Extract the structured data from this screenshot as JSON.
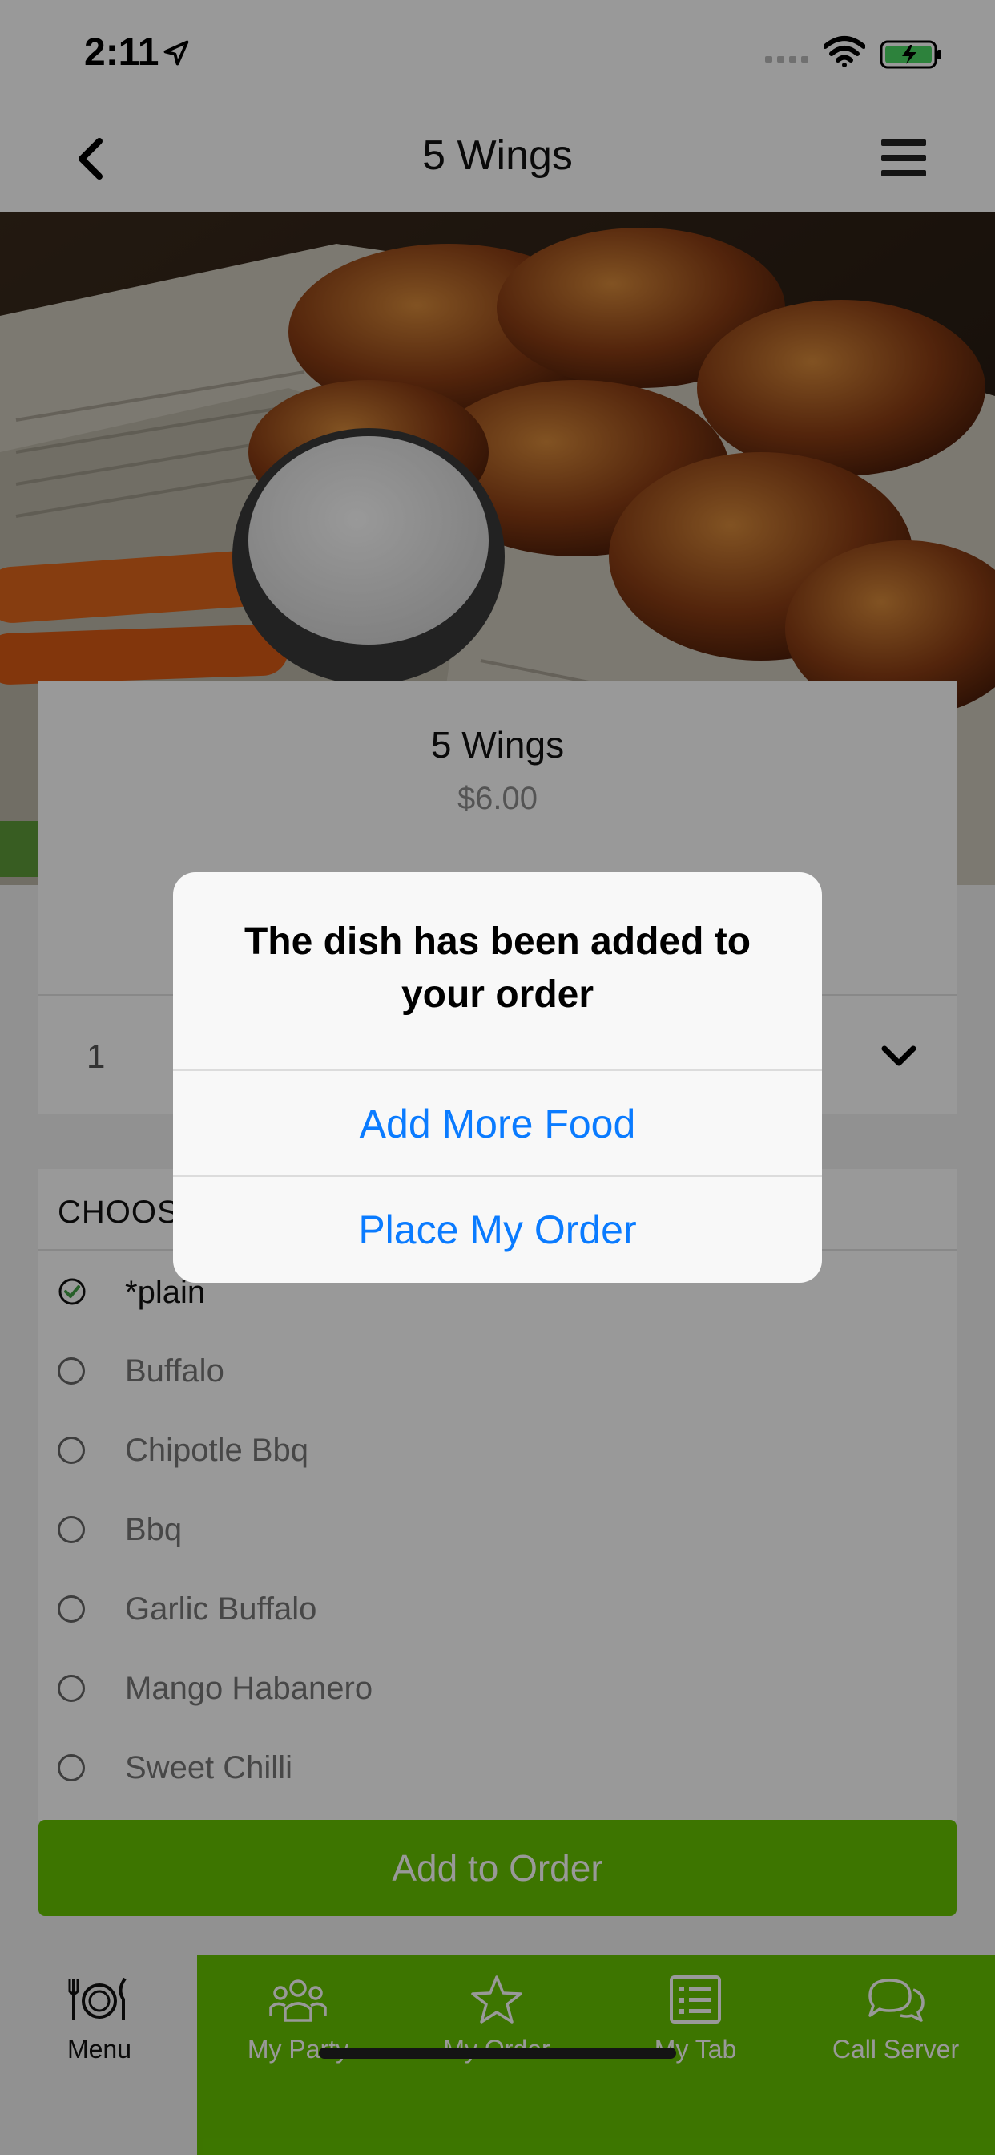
{
  "status_bar": {
    "time": "2:11",
    "icons": [
      "location-arrow-icon",
      "signal-icon",
      "wifi-icon",
      "battery-icon"
    ]
  },
  "nav": {
    "title": "5 Wings",
    "back_icon": "chevron-left-icon",
    "menu_icon": "hamburger-menu-icon"
  },
  "item": {
    "name": "5 Wings",
    "price": "$6.00",
    "quantity": "1"
  },
  "options": {
    "header": "CHOOS",
    "items": [
      {
        "label": "*plain",
        "selected": true
      },
      {
        "label": "Buffalo",
        "selected": false
      },
      {
        "label": "Chipotle Bbq",
        "selected": false
      },
      {
        "label": "Bbq",
        "selected": false
      },
      {
        "label": "Garlic Buffalo",
        "selected": false
      },
      {
        "label": "Mango Habanero",
        "selected": false
      },
      {
        "label": "Sweet Chilli",
        "selected": false
      }
    ]
  },
  "add_button": {
    "label": "Add to Order"
  },
  "tab_bar": {
    "tabs": [
      {
        "label": "Menu",
        "icon": "plate-cutlery-icon",
        "active": true
      },
      {
        "label": "My Party",
        "icon": "group-icon",
        "active": false
      },
      {
        "label": "My Order",
        "icon": "star-icon",
        "active": false
      },
      {
        "label": "My Tab",
        "icon": "list-icon",
        "active": false
      },
      {
        "label": "Call Server",
        "icon": "chat-bubbles-icon",
        "active": false
      }
    ]
  },
  "alert": {
    "title": "The dish has been added to your order",
    "buttons": [
      "Add More Food",
      "Place My Order"
    ]
  },
  "colors": {
    "brand_green": "#66c400",
    "alert_link": "#0a7bff",
    "check_green": "#43a047"
  }
}
